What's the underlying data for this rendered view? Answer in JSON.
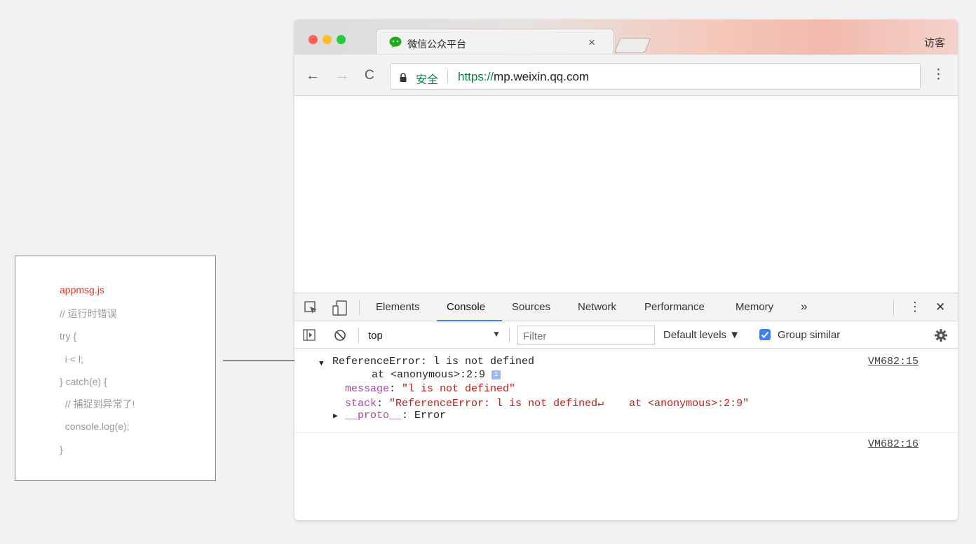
{
  "code_card": {
    "filename": "appmsg.js",
    "lines": [
      "// 运行时错误",
      "try {",
      "  i < l;",
      "} catch(e) {",
      "  // 捕捉到异常了!",
      "  console.log(e);",
      "}"
    ]
  },
  "browser": {
    "tab_title": "微信公众平台",
    "tab_close": "×",
    "profile": "访客",
    "nav": {
      "back": "←",
      "forward": "→",
      "reload": "C"
    },
    "security_label": "安全",
    "url_scheme": "https://",
    "url_host": "mp.weixin.qq.com",
    "menu": "⋮"
  },
  "devtools": {
    "tabs": [
      "Elements",
      "Console",
      "Sources",
      "Network",
      "Performance",
      "Memory"
    ],
    "active_tab": "Console",
    "more_tabs": "»",
    "menu": "⋮",
    "close": "✕",
    "context": "top",
    "context_caret": "▼",
    "filter_placeholder": "Filter",
    "levels_label": "Default levels ▼",
    "group_similar_label": "Group similar",
    "group_similar_checked": true
  },
  "console": {
    "error_header": "ReferenceError: l is not defined",
    "error_location": "at <anonymous>:2:9",
    "info_badge": "i",
    "source_link_1": "VM682:15",
    "message_key": "message",
    "message_value": "\"l is not defined\"",
    "stack_key": "stack",
    "stack_value": "\"ReferenceError: l is not defined↵    at <anonymous>:2:9\"",
    "proto_key": "__proto__",
    "proto_value": "Error",
    "source_link_2": "VM682:16",
    "expand_open": "▼",
    "expand_closed": "▶"
  },
  "colors": {
    "accent_blue": "#3f80f0",
    "error_red": "#c41a16",
    "property_purple": "#a84aa8",
    "secure_green": "#0b8043",
    "filename_red": "#d8382f"
  }
}
